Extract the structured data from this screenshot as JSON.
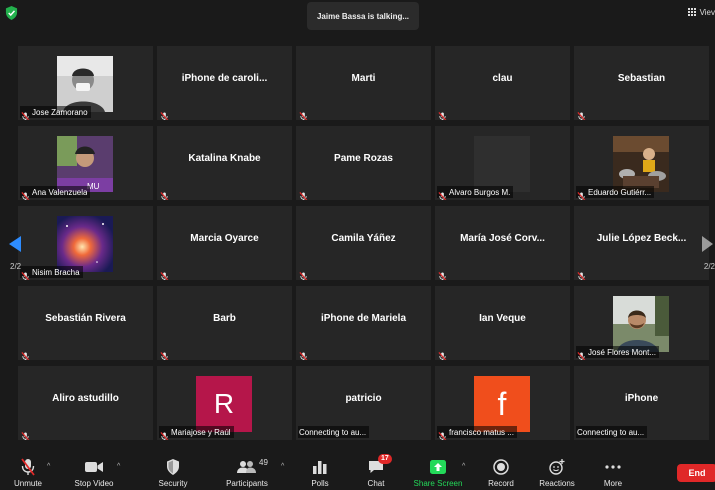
{
  "top": {
    "talking": "Jaime Bassa is talking...",
    "view_label": "Viev"
  },
  "tiles": [
    {
      "name": "Jose Zamorano",
      "type": "photo"
    },
    {
      "name": "iPhone  de  caroli...",
      "type": "text"
    },
    {
      "name": "Marti",
      "type": "text"
    },
    {
      "name": "clau",
      "type": "text"
    },
    {
      "name": "Sebastian",
      "type": "text"
    },
    {
      "name": "Ana Valenzuela",
      "type": "photo"
    },
    {
      "name": "Katalina Knabe",
      "type": "text"
    },
    {
      "name": "Pame Rozas",
      "type": "text"
    },
    {
      "name": "Alvaro Burgos M.",
      "type": "blank"
    },
    {
      "name": "Eduardo Gutiérr...",
      "type": "photo"
    },
    {
      "name": "Nisim Bracha",
      "type": "photo"
    },
    {
      "name": "Marcia Oyarce",
      "type": "text"
    },
    {
      "name": "Camila Yáñez",
      "type": "text"
    },
    {
      "name": "María José Corv...",
      "type": "text"
    },
    {
      "name": "Julie López Beck...",
      "type": "text"
    },
    {
      "name": "Sebastián Rivera",
      "type": "text"
    },
    {
      "name": "Barb",
      "type": "text"
    },
    {
      "name": "iPhone de Mariela",
      "type": "text"
    },
    {
      "name": "Ian Veque",
      "type": "text"
    },
    {
      "name": "José Flores Mont...",
      "type": "photo"
    },
    {
      "name": "Aliro astudillo",
      "type": "text"
    },
    {
      "name": "Mariajose y Raúl",
      "type": "avatar",
      "letter": "R"
    },
    {
      "name": "patricio",
      "type": "text",
      "caption": "Connecting to au..."
    },
    {
      "name": "francisco matus ...",
      "type": "avatar",
      "letter": "f"
    },
    {
      "name": "iPhone",
      "type": "text",
      "caption": "Connecting to au..."
    }
  ],
  "pagination": {
    "left": "2/2",
    "right": "2/2"
  },
  "toolbar": {
    "unmute": "Unmute",
    "stop_video": "Stop Video",
    "security": "Security",
    "participants": "Participants",
    "participants_count": "49",
    "polls": "Polls",
    "chat": "Chat",
    "chat_badge": "17",
    "share_screen": "Share Screen",
    "record": "Record",
    "reactions": "Reactions",
    "more": "More",
    "end": "End"
  },
  "colors": {
    "accent": "#2d8cff",
    "share_green": "#23d959",
    "end_red": "#e02828",
    "avatar_r": "#b5164a",
    "avatar_f": "#f04e1c",
    "shield_green": "#23b14d"
  }
}
